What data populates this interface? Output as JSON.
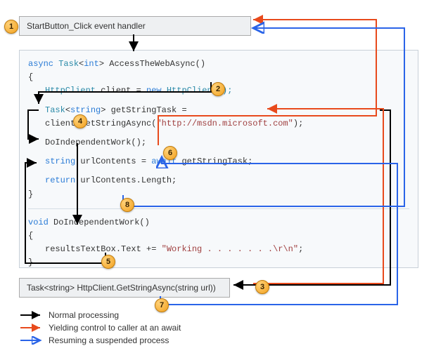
{
  "header_box": "StartButton_Click event handler",
  "footer_box": "Task<string> HttpClient.GetStringAsync(string url))",
  "code": {
    "sig_async": "async",
    "sig_task": "Task",
    "sig_int": "int",
    "sig_name": "AccessTheWebAsync()",
    "l1_type": "HttpClient",
    "l1_var": "client =",
    "l1_new": "new",
    "l1_ctor": "HttpClient();",
    "l2_task": "Task",
    "l2_str": "string",
    "l2_rest": "getStringTask = client.GetStringAsync(",
    "l2_url": "\"http://msdn.microsoft.com\"",
    "l2_end": ");",
    "l3": "DoIndependentWork();",
    "l4a_type": "string",
    "l4a_var": "urlContents =",
    "l4a_await": "await",
    "l4a_task": "getStringTask;",
    "l5a_ret": "return",
    "l5a_rest": "urlContents.Length;",
    "close1": "}",
    "sub_sig_void": "void",
    "sub_sig_name": "DoIndependentWork()",
    "sub_l1": "resultsTextBox.Text +=",
    "sub_l1_str": "\"Working . . . . . . .\\r\\n\"",
    "sub_l1_end": ";",
    "sub_close": "}"
  },
  "badges": {
    "b1": "1",
    "b2": "2",
    "b3": "3",
    "b4": "4",
    "b5": "5",
    "b6": "6",
    "b7": "7",
    "b8": "8"
  },
  "legend": {
    "normal": "Normal processing",
    "yield": "Yielding control to caller at an await",
    "resume": "Resuming a suspended process"
  }
}
